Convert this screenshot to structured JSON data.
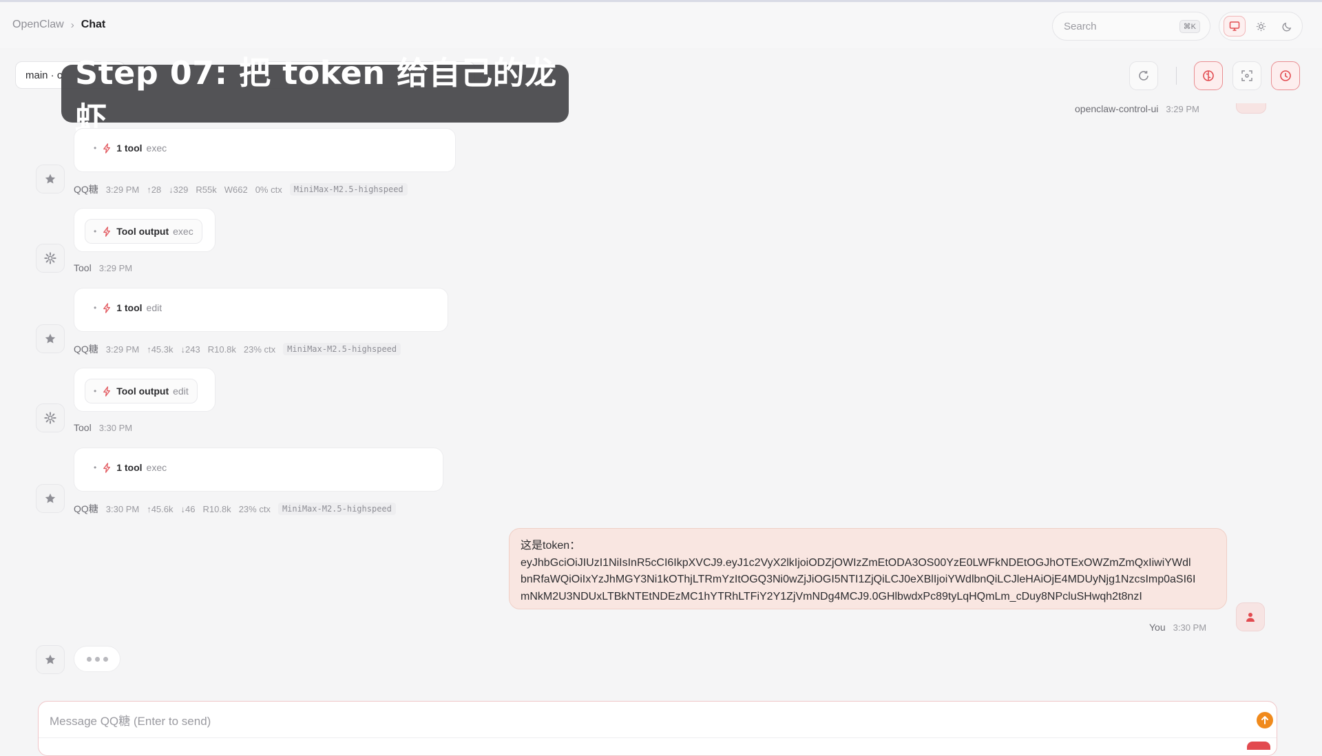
{
  "breadcrumb": {
    "root": "OpenClaw",
    "separator": "›",
    "current": "Chat"
  },
  "search": {
    "placeholder": "Search",
    "shortcut": "⌘K"
  },
  "session": {
    "label": "main · c"
  },
  "overlay": {
    "text": "Step 07: 把 token 给自己的龙虾"
  },
  "top_message_meta": {
    "sender": "openclaw-control-ui",
    "time": "3:29 PM"
  },
  "messages": [
    {
      "kind": "assistant",
      "tool_count": "1 tool",
      "tool_type": "exec",
      "meta": {
        "sender": "QQ糖",
        "time": "3:29 PM",
        "up": "↑28",
        "down": "↓329",
        "r": "R55k",
        "w": "W662",
        "ctx": "0% ctx",
        "model": "MiniMax-M2.5-highspeed"
      }
    },
    {
      "kind": "tool",
      "label": "Tool output",
      "tool_type": "exec",
      "meta": {
        "sender": "Tool",
        "time": "3:29 PM"
      }
    },
    {
      "kind": "assistant",
      "tool_count": "1 tool",
      "tool_type": "edit",
      "meta": {
        "sender": "QQ糖",
        "time": "3:29 PM",
        "up": "↑45.3k",
        "down": "↓243",
        "r": "R10.8k",
        "ctx": "23% ctx",
        "model": "MiniMax-M2.5-highspeed"
      }
    },
    {
      "kind": "tool",
      "label": "Tool output",
      "tool_type": "edit",
      "meta": {
        "sender": "Tool",
        "time": "3:30 PM"
      }
    },
    {
      "kind": "assistant",
      "tool_count": "1 tool",
      "tool_type": "exec",
      "meta": {
        "sender": "QQ糖",
        "time": "3:30 PM",
        "up": "↑45.6k",
        "down": "↓46",
        "r": "R10.8k",
        "ctx": "23% ctx",
        "model": "MiniMax-M2.5-highspeed"
      }
    }
  ],
  "user_message": {
    "line1": "这是token：",
    "line2": "eyJhbGciOiJIUzI1NiIsInR5cCI6IkpXVCJ9.eyJ1c2VyX2lkIjoiODZjOWIzZmEtODA3OS00YzE0LWFkNDEtOGJhOTExOWZmZmQxIiwiYWdl",
    "line3": "bnRfaWQiOiIxYzJhMGY3Ni1kOThjLTRmYzItOGQ3Ni0wZjJiOGI5NTI1ZjQiLCJ0eXBlIjoiYWdlbnQiLCJleHAiOjE4MDUyNjg1NzcsImp0aSI6I",
    "line4": "mNkM2U3NDUxLTBkNTEtNDEzMC1hYTRhLTFiY2Y1ZjVmNDg4MCJ9.0GHlbwdxPc89tyLqHQmLm_cDuy8NPcluSHwqh2t8nzI",
    "sender": "You",
    "time": "3:30 PM"
  },
  "composer": {
    "placeholder": "Message QQ糖 (Enter to send)"
  },
  "colors": {
    "accent": "#e24a4f",
    "send": "#f08a1c",
    "user_bubble": "#f9e6e1",
    "tool_icon": "#e25b61"
  }
}
